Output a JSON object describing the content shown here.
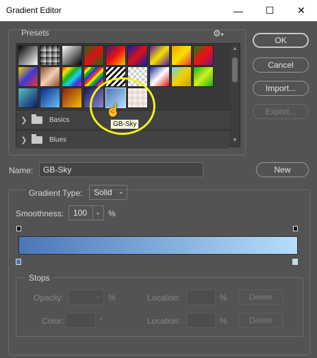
{
  "window": {
    "title": "Gradient Editor",
    "minimize": "—",
    "maximize": "☐",
    "close": "✕"
  },
  "presets": {
    "label": "Presets",
    "gear_icon": "⚙",
    "selected_tooltip": "GB-Sky",
    "folders": [
      {
        "label": "Basics"
      },
      {
        "label": "Blues"
      }
    ]
  },
  "buttons": {
    "ok": "OK",
    "cancel": "Cancel",
    "import": "Import...",
    "export": "Export...",
    "new": "New"
  },
  "name": {
    "label": "Name:",
    "value": "GB-Sky"
  },
  "gradient_type": {
    "label": "Gradient Type:",
    "value": "Solid"
  },
  "smoothness": {
    "label": "Smoothness:",
    "value": "100",
    "unit": "%"
  },
  "stops": {
    "label": "Stops",
    "opacity_label": "Opacity:",
    "opacity_unit": "%",
    "location_label": "Location:",
    "location_unit": "%",
    "color_label": "Color:",
    "delete_label": "Delete"
  },
  "colors": {
    "gradient_start": "#4a76b8",
    "gradient_end": "#b6defb",
    "highlight": "#f2f21a"
  }
}
